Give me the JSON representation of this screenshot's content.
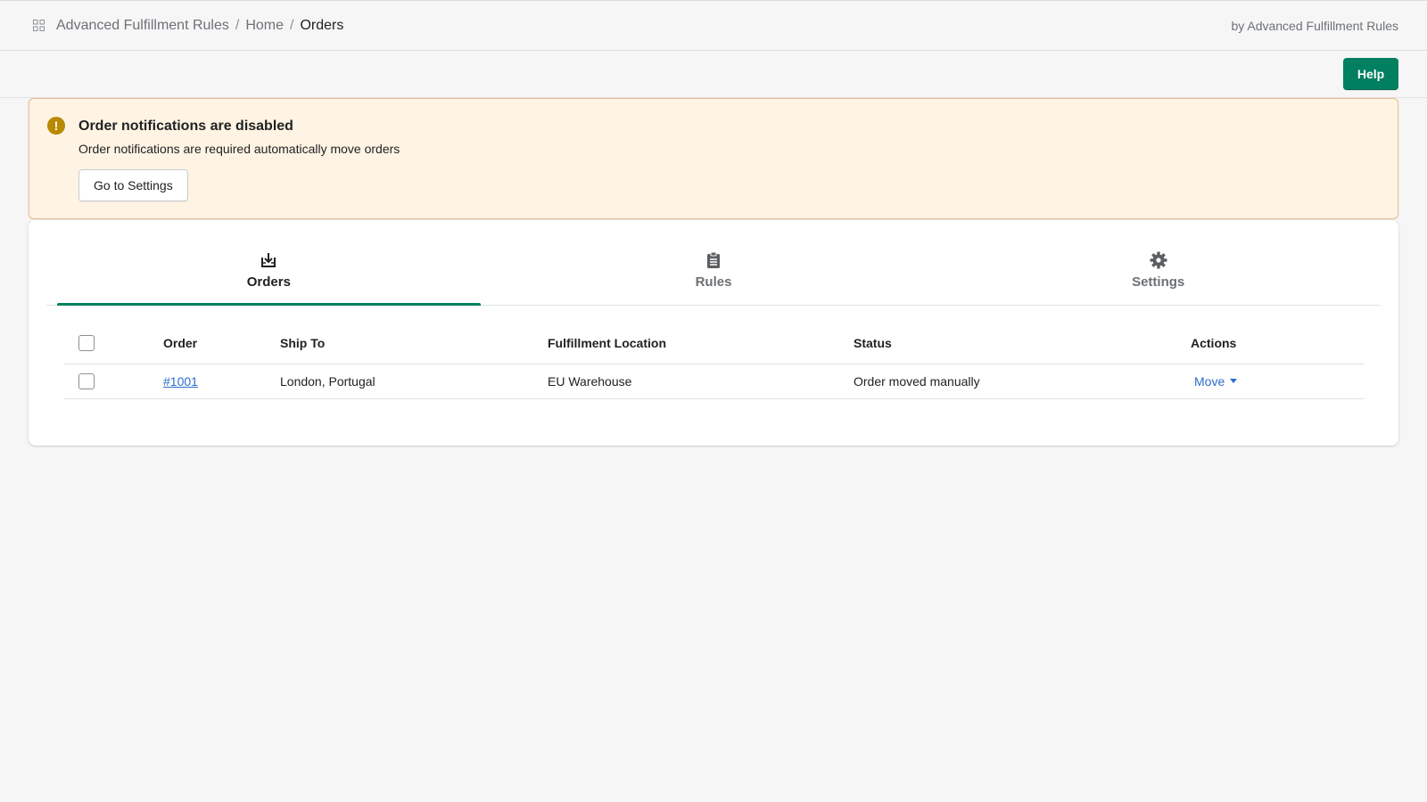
{
  "topbar": {
    "app_icon": "app-grid-icon",
    "breadcrumb": [
      "Advanced Fulfillment Rules",
      "Home",
      "Orders"
    ],
    "separator": "/",
    "byline": "by Advanced Fulfillment Rules"
  },
  "actionbar": {
    "help_label": "Help"
  },
  "banner": {
    "icon": "warning-icon",
    "icon_glyph": "!",
    "title": "Order notifications are disabled",
    "text": "Order notifications are required automatically move orders",
    "button_label": "Go to Settings"
  },
  "tabs": [
    {
      "label": "Orders",
      "icon": "order-download-icon",
      "active": true
    },
    {
      "label": "Rules",
      "icon": "clipboard-icon",
      "active": false
    },
    {
      "label": "Settings",
      "icon": "gear-icon",
      "active": false
    }
  ],
  "table": {
    "headers": [
      "Order",
      "Ship To",
      "Fulfillment Location",
      "Status",
      "Actions"
    ],
    "rows": [
      {
        "order": "#1001",
        "ship_to": "London, Portugal",
        "location": "EU Warehouse",
        "status": "Order moved manually",
        "action": "Move"
      }
    ]
  },
  "colors": {
    "primary": "#008060",
    "link": "#2c6ecb",
    "banner_bg": "#fff4e4",
    "banner_border": "#e6c29a",
    "warning": "#b98900"
  }
}
